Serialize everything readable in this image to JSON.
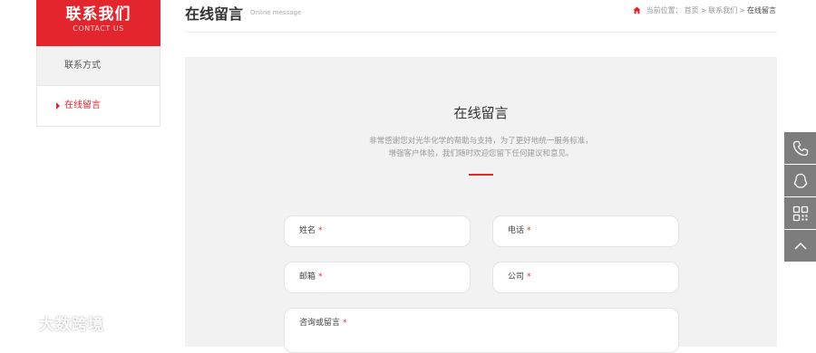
{
  "sidebar": {
    "title": "联系我们",
    "subtitle": "CONTACT US",
    "items": [
      {
        "label": "联系方式"
      },
      {
        "label": "在线留言"
      }
    ]
  },
  "header": {
    "title": "在线留言",
    "subtitle": "Online message",
    "breadcrumb": {
      "prefix": "当前位置：",
      "items": [
        "首页",
        "联系我们",
        "在线留言"
      ],
      "separator": ">"
    }
  },
  "form": {
    "title": "在线留言",
    "description_lines": [
      "非常感谢您对光华化学的帮助与支持，为了更好地统一服务标准，",
      "增强客户体验，我们随时欢迎您留下任何建议和意见。"
    ],
    "required_mark": "*",
    "fields": {
      "name": "姓名",
      "phone": "电话",
      "email": "邮箱",
      "company": "公司",
      "message": "咨询或留言"
    }
  },
  "tools": [
    "phone-icon",
    "qq-icon",
    "qrcode-icon",
    "back-to-top-icon"
  ],
  "watermark": {
    "text": "大数跨境",
    "logo": "KC"
  },
  "colors": {
    "accent": "#e3262d",
    "panel_bg": "#f2f2f2",
    "tool_bg": "#7d7d7d"
  }
}
